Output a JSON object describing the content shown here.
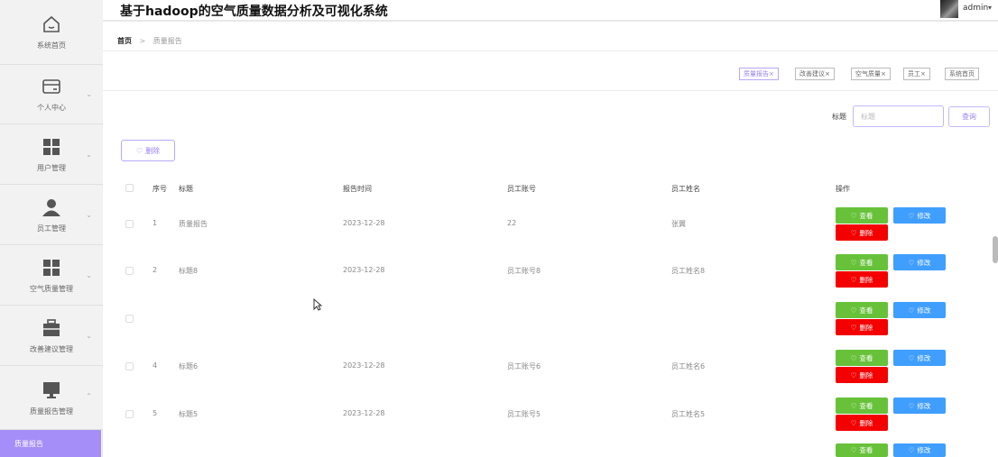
{
  "app": {
    "title": "基于hadoop的空气质量数据分析及可视化系统",
    "user": "admin"
  },
  "sidebar": {
    "items": [
      {
        "label": "系统首页",
        "icon": "home-icon"
      },
      {
        "label": "个人中心",
        "icon": "card-icon"
      },
      {
        "label": "用户管理",
        "icon": "grid-icon"
      },
      {
        "label": "员工管理",
        "icon": "person-icon"
      },
      {
        "label": "空气质量管理",
        "icon": "grid-icon"
      },
      {
        "label": "改善建议管理",
        "icon": "briefcase-icon"
      },
      {
        "label": "质量报告管理",
        "icon": "monitor-icon"
      }
    ],
    "active_sub": "质量报告"
  },
  "breadcrumb": {
    "home": "首页",
    "separator": ">",
    "current": "质量报告"
  },
  "tags": [
    "质量报告",
    "改善建议",
    "空气质量",
    "员工",
    "系统首页"
  ],
  "search": {
    "label": "标题",
    "placeholder": "标题",
    "button": "查询"
  },
  "toolbar": {
    "delete_label": "删除"
  },
  "table": {
    "headers": {
      "index": "序号",
      "title": "标题",
      "time": "报告时间",
      "account": "员工账号",
      "name": "员工姓名",
      "ops": "操作"
    },
    "rows": [
      {
        "index": "1",
        "title": "质量报告",
        "time": "2023-12-28",
        "account": "22",
        "name": "张翼"
      },
      {
        "index": "2",
        "title": "标题8",
        "time": "2023-12-28",
        "account": "员工账号8",
        "name": "员工姓名8"
      },
      {
        "index": "",
        "title": "",
        "time": "",
        "account": "",
        "name": ""
      },
      {
        "index": "4",
        "title": "标题6",
        "time": "2023-12-28",
        "account": "员工账号6",
        "name": "员工姓名6"
      },
      {
        "index": "5",
        "title": "标题5",
        "time": "2023-12-28",
        "account": "员工账号5",
        "name": "员工姓名5"
      }
    ],
    "actions": {
      "view": "查看",
      "edit": "修改",
      "delete": "删除"
    }
  },
  "colors": {
    "accent": "#a58ef8",
    "view": "#67c23a",
    "edit": "#409eff",
    "delete": "#f40000"
  }
}
